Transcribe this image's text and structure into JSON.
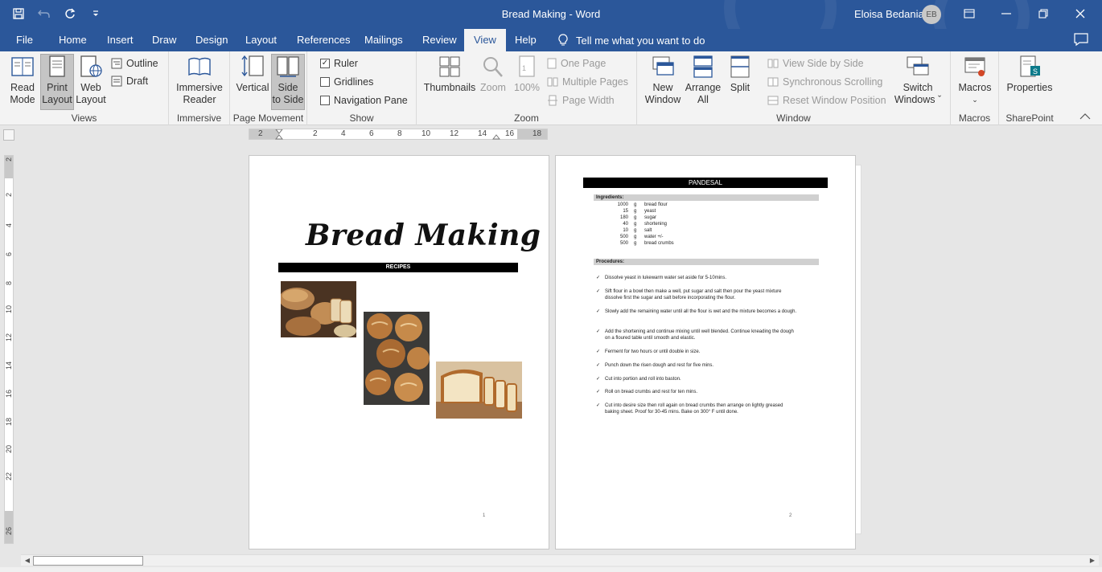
{
  "window": {
    "title": "Bread Making  -  Word",
    "user_name": "Eloisa Bedania",
    "user_initials": "EB"
  },
  "quick_access": [
    "save-icon",
    "undo-icon",
    "redo-icon",
    "customize-icon"
  ],
  "tabs": [
    {
      "label": "File"
    },
    {
      "label": "Home"
    },
    {
      "label": "Insert"
    },
    {
      "label": "Draw"
    },
    {
      "label": "Design"
    },
    {
      "label": "Layout"
    },
    {
      "label": "References"
    },
    {
      "label": "Mailings"
    },
    {
      "label": "Review"
    },
    {
      "label": "View",
      "active": true
    },
    {
      "label": "Help"
    }
  ],
  "tell_me": "Tell me what you want to do",
  "ribbon": {
    "views": {
      "label": "Views",
      "read_mode": [
        "Read",
        "Mode"
      ],
      "print_layout": [
        "Print",
        "Layout"
      ],
      "web_layout": [
        "Web",
        "Layout"
      ],
      "outline": "Outline",
      "draft": "Draft"
    },
    "immersive": {
      "label": "Immersive",
      "reader": [
        "Immersive",
        "Reader"
      ]
    },
    "page_movement": {
      "label": "Page Movement",
      "vertical": "Vertical",
      "side_to_side": [
        "Side",
        "to Side"
      ]
    },
    "show": {
      "label": "Show",
      "ruler": "Ruler",
      "ruler_checked": true,
      "gridlines": "Gridlines",
      "gridlines_checked": false,
      "nav_pane": "Navigation Pane",
      "nav_pane_checked": false
    },
    "zoom": {
      "label": "Zoom",
      "thumbnails": "Thumbnails",
      "zoom": "Zoom",
      "percent": "100%",
      "one_page": "One Page",
      "multiple_pages": "Multiple Pages",
      "page_width": "Page Width"
    },
    "window": {
      "label": "Window",
      "new_window": [
        "New",
        "Window"
      ],
      "arrange_all": [
        "Arrange",
        "All"
      ],
      "split": "Split",
      "view_side_by_side": "View Side by Side",
      "sync_scrolling": "Synchronous Scrolling",
      "reset_position": "Reset Window Position",
      "switch_windows": [
        "Switch",
        "Windows ˇ"
      ]
    },
    "macros": {
      "label": "Macros",
      "macros": "Macros"
    },
    "sharepoint": {
      "label": "SharePoint",
      "properties": "Properties"
    }
  },
  "ruler": {
    "h_numbers": [
      "2",
      "2",
      "4",
      "6",
      "8",
      "10",
      "12",
      "14",
      "16",
      "18"
    ],
    "v_numbers": [
      "2",
      "2",
      "4",
      "6",
      "8",
      "10",
      "12",
      "14",
      "16",
      "18",
      "20",
      "22",
      "26"
    ]
  },
  "page1": {
    "title": "Bread Making",
    "recipes_label": "RECIPES",
    "page_number": "1"
  },
  "page2": {
    "heading": "PANDESAL",
    "ingredients_label": "Ingredients:",
    "ingredients": [
      {
        "qty": "1000",
        "unit": "g",
        "name": "bread flour"
      },
      {
        "qty": "15",
        "unit": "g",
        "name": "yeast"
      },
      {
        "qty": "180",
        "unit": "g",
        "name": "sugar"
      },
      {
        "qty": "40",
        "unit": "g",
        "name": "shortening"
      },
      {
        "qty": "10",
        "unit": "g",
        "name": "salt"
      },
      {
        "qty": "500",
        "unit": "g",
        "name": "water +/-"
      },
      {
        "qty": "500",
        "unit": "g",
        "name": "bread crumbs"
      }
    ],
    "procedures_label": "Procedures:",
    "steps": [
      "Dissolve yeast in lukewarm water set aside for 5-10mins.",
      "Sift flour in a bowl then make a well, put sugar and salt then pour the yeast mixture dissolve first the sugar and salt before incorporating the flour.",
      "Slowly add the remaining water until all the flour is wet and the mixture becomes a dough.",
      "Add the shortening and continue mixing until well blended. Continue kneading the dough on a floured table until smooth and elastic.",
      "Ferment for two hours or until double in size.",
      "Punch down the risen dough and rest for five mins.",
      "Cut into portion and roll into baston.",
      "Roll on bread crumbs and rest for ten mins.",
      "Cut into desire size then roll again on bread crumbs then arrange on lightly greased baking sheet. Proof for 30-45 mins. Bake on 300° F until done."
    ],
    "page_number": "2"
  }
}
